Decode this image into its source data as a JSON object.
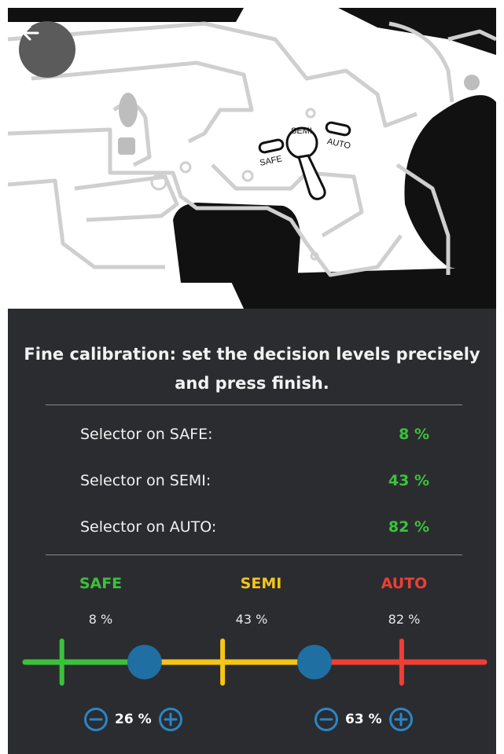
{
  "back_button": {
    "icon": "arrow-left-icon"
  },
  "illustration": {
    "labels": {
      "safe": "SAFE",
      "semi": "SEMI",
      "auto": "AUTO"
    }
  },
  "instruction": "Fine calibration: set the decision levels precisely and press finish.",
  "readings": [
    {
      "label": "Selector on SAFE:",
      "value": "8 %"
    },
    {
      "label": "Selector on SEMI:",
      "value": "43 %"
    },
    {
      "label": "Selector on AUTO:",
      "value": "82 %"
    }
  ],
  "zones": [
    {
      "name": "SAFE",
      "level_text": "8 %",
      "level": 8,
      "color": "#3cc13c"
    },
    {
      "name": "SEMI",
      "level_text": "43 %",
      "level": 43,
      "color": "#f5c518"
    },
    {
      "name": "AUTO",
      "level_text": "82 %",
      "level": 82,
      "color": "#ef3e36"
    }
  ],
  "thresholds": [
    {
      "value_text": "26 %",
      "value": 26
    },
    {
      "value_text": "63 %",
      "value": 63
    }
  ],
  "colors": {
    "background": "#2b2c30",
    "handle": "#1f6fa3",
    "stepper_icon": "#2a86c8",
    "reading_value": "#3cc13c"
  }
}
